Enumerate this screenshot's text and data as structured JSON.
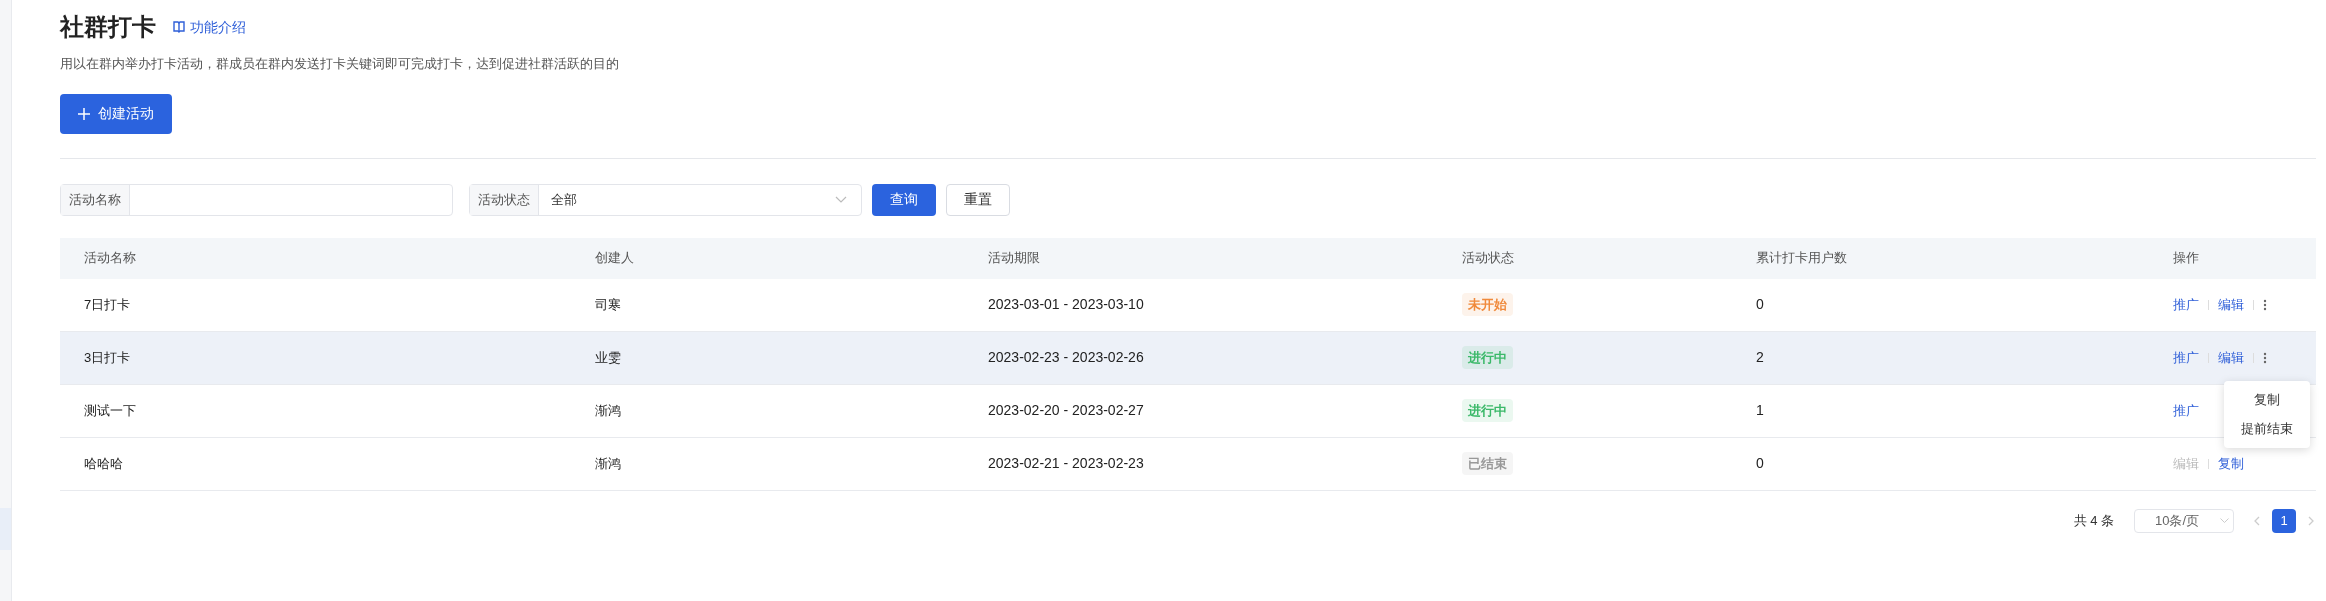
{
  "header": {
    "title": "社群打卡",
    "intro_link": "功能介绍",
    "description": "用以在群内举办打卡活动，群成员在群内发送打卡关键词即可完成打卡，达到促进社群活跃的目的",
    "create_button": "创建活动"
  },
  "filters": {
    "name_label": "活动名称",
    "status_label": "活动状态",
    "status_value": "全部",
    "query_button": "查询",
    "reset_button": "重置"
  },
  "table": {
    "columns": [
      "活动名称",
      "创建人",
      "活动期限",
      "活动状态",
      "累计打卡用户数",
      "操作"
    ],
    "rows": [
      {
        "name": "7日打卡",
        "creator": "司寒",
        "period": "2023-03-01 - 2023-03-10",
        "status": {
          "label": "未开始",
          "color": "#f08a3c"
        },
        "count": "0",
        "selected": false,
        "actions": [
          {
            "label": "推广",
            "disabled": false
          },
          {
            "label": "编辑",
            "disabled": false
          }
        ],
        "more": true
      },
      {
        "name": "3日打卡",
        "creator": "业雯",
        "period": "2023-02-23 - 2023-02-26",
        "status": {
          "label": "进行中",
          "color": "#3cb96a"
        },
        "count": "2",
        "selected": true,
        "actions": [
          {
            "label": "推广",
            "disabled": false
          },
          {
            "label": "编辑",
            "disabled": false
          }
        ],
        "more": true,
        "menu": [
          "复制",
          "提前结束"
        ]
      },
      {
        "name": "测试一下",
        "creator": "渐鸿",
        "period": "2023-02-20 - 2023-02-27",
        "status": {
          "label": "进行中",
          "color": "#3cb96a"
        },
        "count": "1",
        "selected": false,
        "actions": [
          {
            "label": "推广",
            "disabled": false
          }
        ],
        "more": false
      },
      {
        "name": "哈哈哈",
        "creator": "渐鸿",
        "period": "2023-02-21 - 2023-02-23",
        "status": {
          "label": "已结束",
          "color": "#999999"
        },
        "count": "0",
        "selected": false,
        "actions": [
          {
            "label": "编辑",
            "disabled": true
          },
          {
            "label": "复制",
            "disabled": false
          }
        ],
        "more": false
      }
    ]
  },
  "pagination": {
    "total": "共 4 条",
    "page_size": "10条/页",
    "pages": [
      {
        "label": "1",
        "selected": true
      }
    ]
  }
}
